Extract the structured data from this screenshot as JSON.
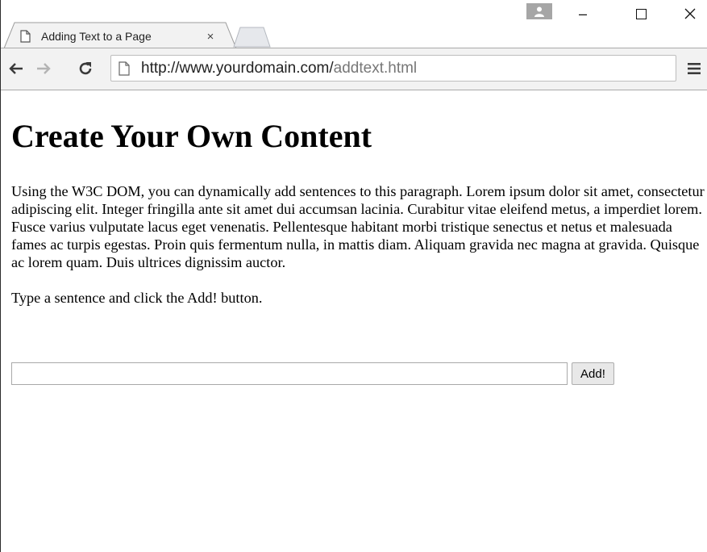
{
  "browser": {
    "tab": {
      "title": "Adding Text to a Page",
      "close_glyph": "×",
      "icon": "page-icon"
    },
    "window_controls": {
      "minimize": "–",
      "maximize": "☐",
      "close": "✕"
    },
    "toolbar": {
      "url_host": "http://www.yourdomain.com/",
      "url_path": "addtext.html",
      "icons": [
        "back-arrow-icon",
        "forward-arrow-icon",
        "reload-icon",
        "page-icon",
        "menu-icon"
      ]
    }
  },
  "page": {
    "heading": "Create Your Own Content",
    "paragraph": "Using the W3C DOM, you can dynamically add sentences to this paragraph. Lorem ipsum dolor sit amet, consectetur adipiscing elit. Integer fringilla ante sit amet dui accumsan lacinia. Curabitur vitae eleifend metus, a imperdiet lorem. Fusce varius vulputate lacus eget venenatis. Pellentesque habitant morbi tristique senectus et netus et malesuada fames ac turpis egestas. Proin quis fermentum nulla, in mattis diam. Aliquam gravida nec magna at gravida. Quisque ac lorem quam. Duis ultrices dignissim auctor.",
    "instructions": "Type a sentence and click the Add! button.",
    "form": {
      "input_value": "",
      "button_label": "Add!"
    }
  }
}
